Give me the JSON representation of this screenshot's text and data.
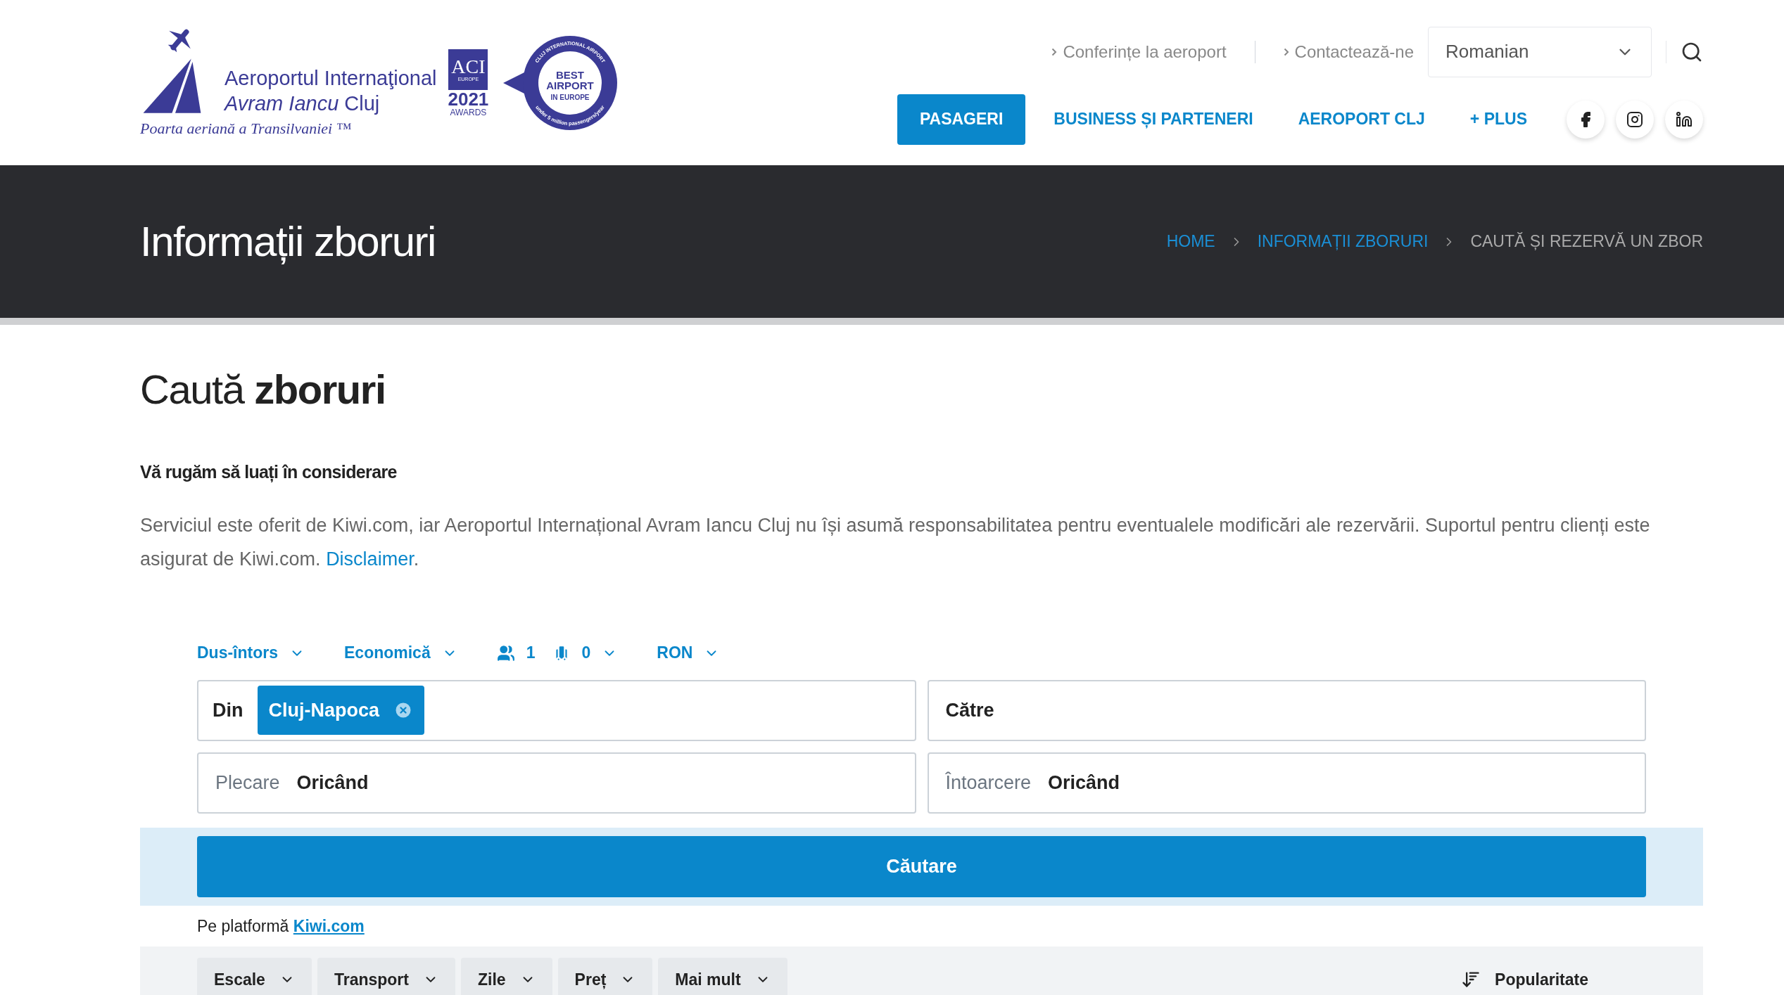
{
  "header": {
    "logo": {
      "line1": "Aeroportul Internaţional",
      "line2_italic": "Avram Iancu",
      "line2_rest": "Cluj",
      "tagline": "Poarta aeriană a Transilvaniei ™"
    },
    "award": {
      "aci": "ACI",
      "region": "EUROPE",
      "year": "2021",
      "label": "AWARDS",
      "badge_lines": [
        "BEST",
        "AIRPORT",
        "IN EUROPE"
      ],
      "ring_top": "CLUJ INTERNATIONAL AIRPORT",
      "ring_bottom": "under 5 million passengers/year"
    },
    "top_links": [
      "Conferințe la aeroport",
      "Contactează-ne"
    ],
    "language": "Romanian",
    "nav": [
      {
        "label": "PASAGERI",
        "selected": true
      },
      {
        "label": "BUSINESS ȘI PARTENERI",
        "selected": false
      },
      {
        "label": "AEROPORT CLJ",
        "selected": false
      },
      {
        "label": "+ PLUS",
        "selected": false
      }
    ]
  },
  "banner": {
    "title": "Informații zboruri",
    "breadcrumb": [
      {
        "label": "HOME",
        "current": false
      },
      {
        "label": "INFORMAȚII ZBORURI",
        "current": false
      },
      {
        "label": "CAUTĂ ȘI REZERVĂ UN ZBOR",
        "current": true
      }
    ]
  },
  "content": {
    "title": "Caută **zboruri**",
    "notice_title": "Vă rugăm să luați în considerare",
    "notice_text": "Serviciul este oferit de Kiwi.com, iar Aeroportul Internațional Avram Iancu Cluj nu își asumă responsabilitatea pentru eventualele modificări ale rezervării. Suportul pentru clienți este asigurat de Kiwi.com.",
    "notice_link": "Disclaimer",
    "notice_end": "."
  },
  "search": {
    "options": [
      {
        "kind": "dropdown",
        "label": "Dus-întors"
      },
      {
        "kind": "dropdown",
        "label": "Economică"
      },
      {
        "kind": "passengers",
        "label": "1"
      },
      {
        "kind": "bags",
        "label": "0"
      },
      {
        "kind": "dropdown",
        "label": "RON"
      }
    ],
    "from": {
      "label": "Din",
      "chip": "Cluj-Napoca"
    },
    "to": {
      "label": "Către"
    },
    "departure": {
      "label": "Plecare",
      "value": "Oricând"
    },
    "return": {
      "label": "Întoarcere",
      "value": "Oricând"
    },
    "button": "Căutare",
    "platform_text": "Pe platformă",
    "platform_link": "Kiwi.com",
    "filters": [
      "Escale",
      "Transport",
      "Zile",
      "Preț",
      "Mai mult"
    ],
    "sort": "Popularitate"
  }
}
